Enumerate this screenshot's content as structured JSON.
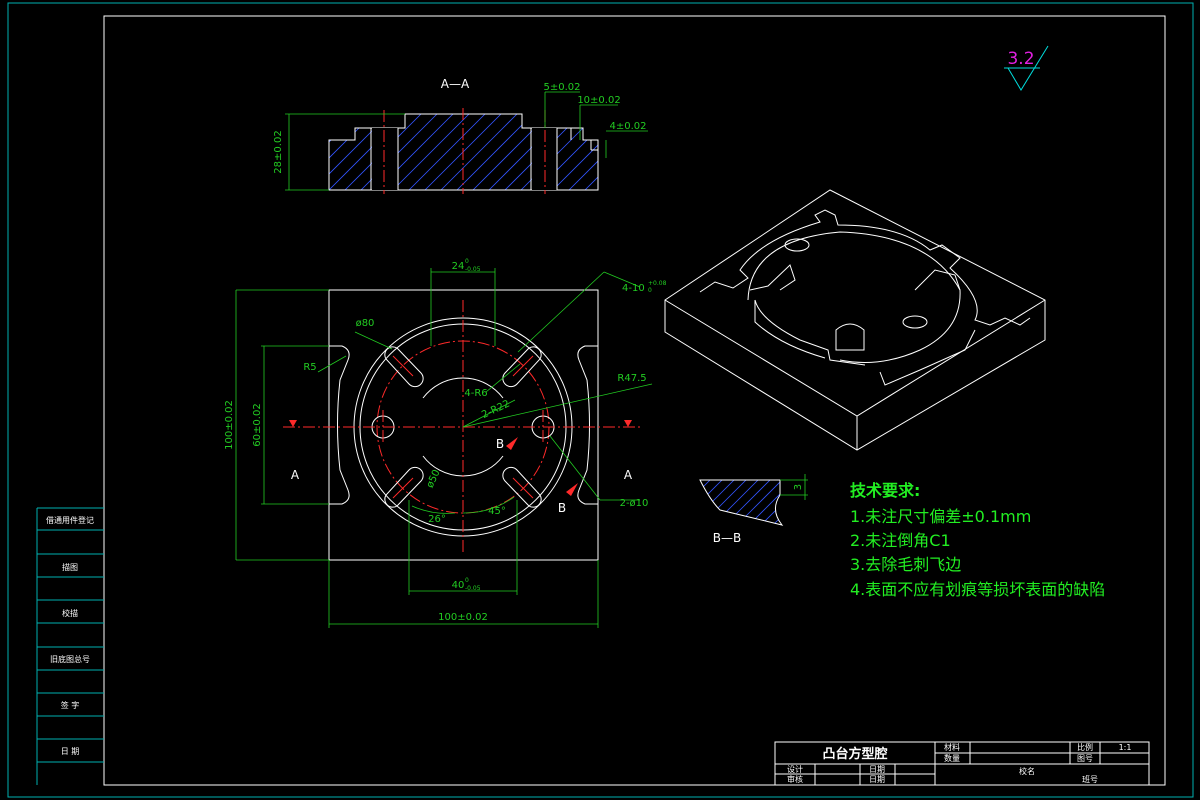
{
  "section_view": {
    "title": "A—A",
    "dims": [
      "5±0.02",
      "10±0.02",
      "4±0.02",
      "28±0.02"
    ]
  },
  "roughness": "3.2",
  "plan_view": {
    "dims": {
      "top_slot": "24",
      "top_slot_tol_upper": "0",
      "top_slot_tol_lower": "-0.05",
      "slots": "4-10",
      "slots_tol_upper": "+0.08",
      "slots_tol_lower": "0",
      "dia80": "ø80",
      "r5": "R5",
      "r6": "4-R6",
      "r22": "2-R22",
      "r47": "R47.5",
      "h100": "100±0.02",
      "h60": "60±0.02",
      "w100": "100±0.02",
      "w40": "40",
      "w40_tol_upper": "0",
      "w40_tol_lower": "-0.05",
      "a26": "26°",
      "a45": "45°",
      "d50": "ø50",
      "holes": "2-ø10"
    },
    "section_marks": {
      "a_left": "A",
      "a_right": "A",
      "b1": "B",
      "b2": "B"
    }
  },
  "bb_view": {
    "title": "B—B",
    "dim": "3"
  },
  "tech_requirements": {
    "title": "技术要求:",
    "items": [
      "1.未注尺寸偏差±0.1mm",
      "2.未注倒角C1",
      "3.去除毛刺飞边",
      "4.表面不应有划痕等损坏表面的缺陷"
    ]
  },
  "left_panel": [
    "借通用件登记",
    "描图",
    "校描",
    "旧底图总号",
    "签  字",
    "日  期"
  ],
  "title_block": {
    "part_name": "凸台方型腔",
    "r1": [
      "设计",
      "日期"
    ],
    "r2": [
      "审核",
      "日期"
    ],
    "mid": [
      "材料",
      "数量"
    ],
    "right": [
      "比例",
      "1:1",
      "图号"
    ],
    "bottom": [
      "校名",
      "班号"
    ]
  }
}
